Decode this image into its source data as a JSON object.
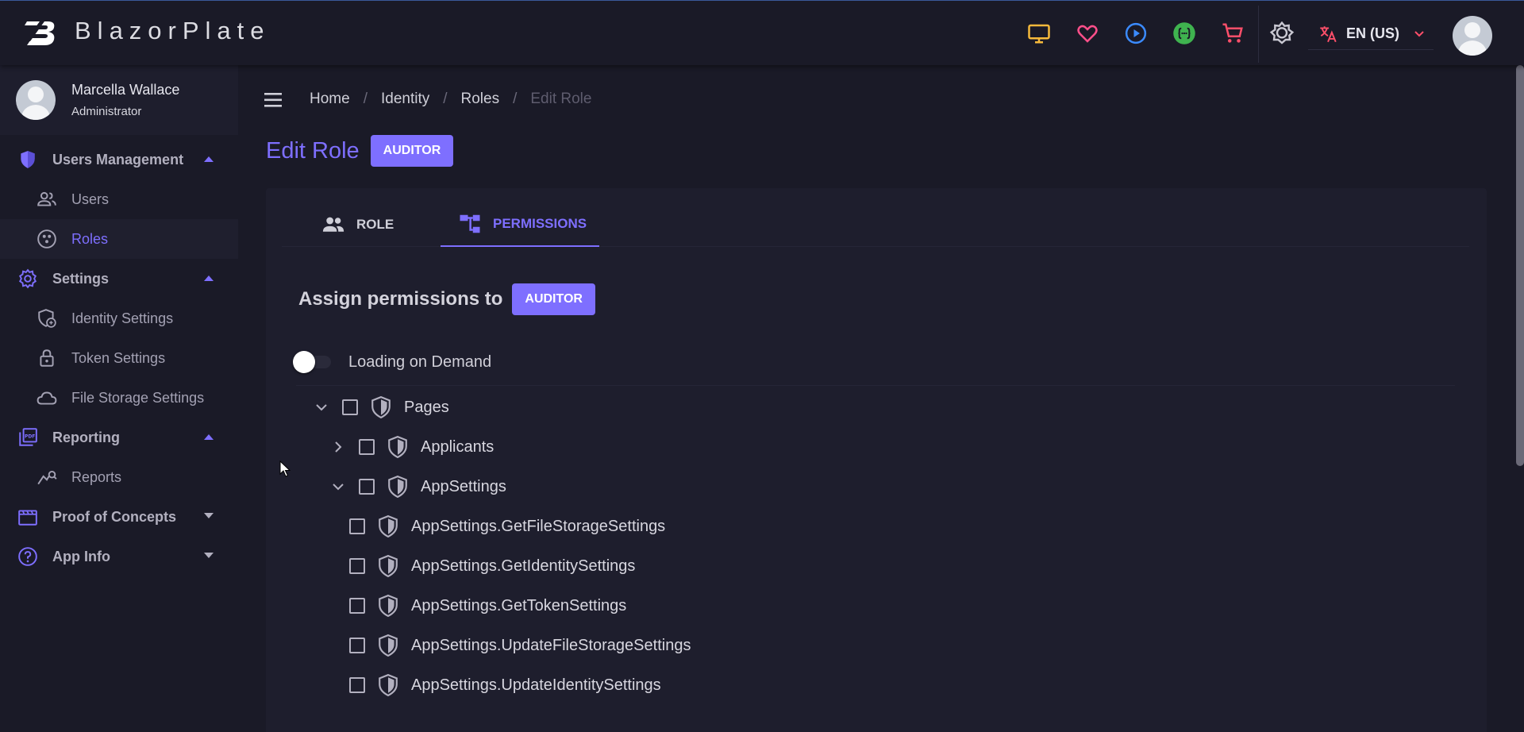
{
  "app": {
    "brand": "BlazorPlate"
  },
  "topbar": {
    "icons": [
      {
        "name": "monitor-icon",
        "color": "#f6b93b"
      },
      {
        "name": "heart-icon",
        "color": "#ff4f8a"
      },
      {
        "name": "play-icon",
        "color": "#3b8bff"
      },
      {
        "name": "api-icon",
        "color": "#3fb34f"
      },
      {
        "name": "cart-icon",
        "color": "#ff4f6a"
      }
    ],
    "language": "EN (US)"
  },
  "sidebar": {
    "user": {
      "name": "Marcella Wallace",
      "role": "Administrator"
    },
    "groups": [
      {
        "label": "Users Management",
        "expanded": true,
        "items": [
          {
            "label": "Users"
          },
          {
            "label": "Roles",
            "active": true
          }
        ]
      },
      {
        "label": "Settings",
        "expanded": true,
        "items": [
          {
            "label": "Identity Settings"
          },
          {
            "label": "Token Settings"
          },
          {
            "label": "File Storage Settings"
          }
        ]
      },
      {
        "label": "Reporting",
        "expanded": true,
        "items": [
          {
            "label": "Reports"
          }
        ]
      },
      {
        "label": "Proof of Concepts",
        "expanded": false,
        "items": []
      },
      {
        "label": "App Info",
        "expanded": false,
        "items": []
      }
    ]
  },
  "breadcrumb": [
    "Home",
    "Identity",
    "Roles",
    "Edit Role"
  ],
  "page": {
    "title": "Edit Role",
    "role_chip": "AUDITOR"
  },
  "tabs": [
    {
      "label": "ROLE"
    },
    {
      "label": "PERMISSIONS",
      "active": true
    }
  ],
  "permissions": {
    "heading": "Assign permissions to",
    "role_chip": "AUDITOR",
    "toggle_label": "Loading on Demand",
    "tree": [
      {
        "label": "Pages",
        "level": 0,
        "expander": "expanded"
      },
      {
        "label": "Applicants",
        "level": 1,
        "expander": "collapsed"
      },
      {
        "label": "AppSettings",
        "level": 1,
        "expander": "expanded"
      },
      {
        "label": "AppSettings.GetFileStorageSettings",
        "level": 2,
        "expander": "none"
      },
      {
        "label": "AppSettings.GetIdentitySettings",
        "level": 2,
        "expander": "none"
      },
      {
        "label": "AppSettings.GetTokenSettings",
        "level": 2,
        "expander": "none"
      },
      {
        "label": "AppSettings.UpdateFileStorageSettings",
        "level": 2,
        "expander": "none"
      },
      {
        "label": "AppSettings.UpdateIdentitySettings",
        "level": 2,
        "expander": "none"
      }
    ]
  },
  "colors": {
    "accent": "#7e6fff",
    "background": "#1a1a27",
    "surface": "#1e1e2d"
  }
}
